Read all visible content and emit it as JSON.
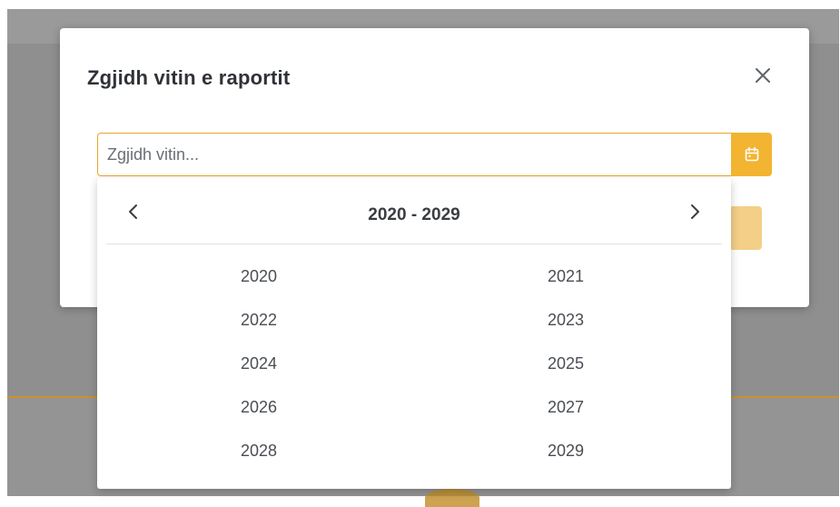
{
  "modal": {
    "title": "Zgjidh vitin e raportit",
    "close_icon": "close-icon"
  },
  "year_input": {
    "placeholder": "Zgjidh vitin...",
    "value": "",
    "button_icon": "calendar-icon"
  },
  "picker": {
    "decade_label": "2020 - 2029",
    "prev_icon": "chevron-left-icon",
    "next_icon": "chevron-right-icon",
    "years": [
      "2020",
      "2021",
      "2022",
      "2023",
      "2024",
      "2025",
      "2026",
      "2027",
      "2028",
      "2029"
    ]
  },
  "colors": {
    "accent": "#f2b431",
    "input_border": "#e8a62a",
    "backdrop": "#8f8f8f"
  }
}
